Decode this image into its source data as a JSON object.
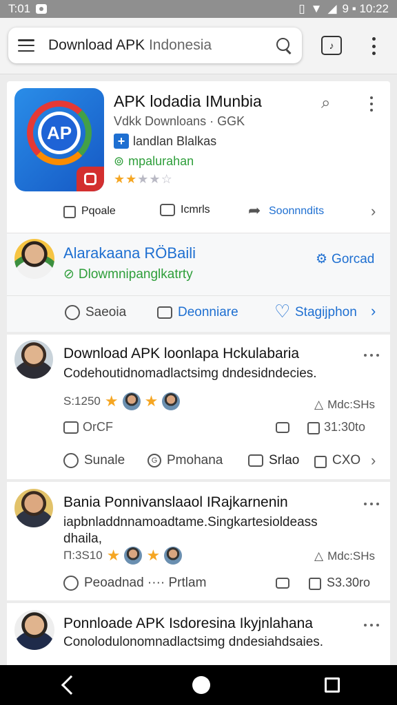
{
  "status_bar": {
    "time": "T:01",
    "right_text": "9 ▪ 10:22"
  },
  "search": {
    "query_bold": "Download",
    "query_rest": "APK",
    "query_muted": "Indonesia"
  },
  "app_card": {
    "icon_letters": "AP",
    "name": "APK lodadia IMunbia",
    "developer": "Vdkk Downloans · GGK",
    "tag": "landlan Blalkas",
    "verified": "mpalurahan",
    "rating": 2.5,
    "actions": {
      "like": "Pqoale",
      "comments": "Icmrls",
      "share": "Soonnndits"
    }
  },
  "featured": {
    "name": "Alarakaana RÖBaili",
    "subtitle": "Dlowmnipanglkatrty",
    "follow": "Gorcad",
    "actions": {
      "a": "Saeoia",
      "b": "Deonniare",
      "c": "Stagijphon"
    }
  },
  "posts": [
    {
      "title": "Download  APK loonlapa Hckulabaria",
      "body": "Codehoutidnomadlactsimg dndesidndecies.",
      "stat": "S:1250",
      "right_stat": "Mdc:SHs",
      "row2_left": "OrCF",
      "row2_right": "31:30to",
      "actions": [
        "Sunale",
        "Pmohana",
        "Srlao",
        "CXO"
      ]
    },
    {
      "title": "Bania   Ponnivanslaaol IRajkarnenin",
      "body": "iapbnladdnnamoadtame.Singkartesioldeass",
      "body2": "dhaila,",
      "stat": "Π:3S10",
      "right_stat": "Mdc:SHs",
      "actions": [
        "Peoadnad ····  Prtlam",
        "S3.30ro"
      ]
    },
    {
      "title": "Ponnloade APK Isdoresina Ikyjnlahana",
      "body": "Conolodulonomnadlactsimg dndesiahdsaies."
    }
  ]
}
